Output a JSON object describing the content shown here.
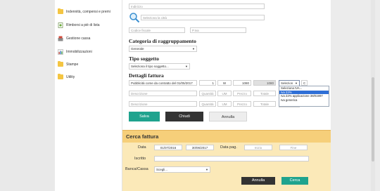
{
  "sidebar": {
    "items": [
      {
        "label": "Indennità, compensi e premi",
        "icon": "folder-icon"
      },
      {
        "label": "Rimborsi a piè di lista",
        "icon": "document-money-icon"
      },
      {
        "label": "Gestione cassa",
        "icon": "cash-register-icon"
      },
      {
        "label": "Immobilizzazioni",
        "icon": "chart-icon"
      },
      {
        "label": "Stampe",
        "icon": "folder-icon"
      },
      {
        "label": "Utility",
        "icon": "folder-icon"
      }
    ]
  },
  "form": {
    "indirizzo_placeholder": "Indirizzo",
    "city_placeholder": "Seleziona la città",
    "codice_fiscale_placeholder": "Codice fiscale",
    "piva_placeholder": "P.Iva",
    "categoria_heading": "Categoria di raggruppamento",
    "categoria_value": "Generale",
    "tipo_heading": "Tipo soggetto",
    "tipo_value": "Seleziona il tipo soggetto...",
    "dettagli_heading": "Dettagli fattura",
    "row1": {
      "descrizione": "Pubblicità come da contratto del 01/05/2017",
      "quantita": "1",
      "um": "W",
      "prezzo": "1080",
      "totale": "1080",
      "iva": "Selezion"
    },
    "row_placeholders": {
      "descrizione": "Descrizione",
      "quantita": "Quantità",
      "um": "UM",
      "prezzo": "Prezzo",
      "totale": "Totale",
      "iva": "Selezion"
    },
    "c_label": "C",
    "iva_options": [
      "Seleziona IVA...",
      "Iva 22%",
      "Iva 22% applicazione 38/01997",
      "Iva generica"
    ],
    "iva_highlight_index": 1,
    "buttons": {
      "salva": "Salva",
      "chiudi": "Chiudi",
      "annulla": "Annulla"
    }
  },
  "cerca": {
    "title": "Cerca fattura",
    "data_label": "Data",
    "data_from": "01/07/2016",
    "data_to": "30/06/2017",
    "data_pag_label": "Data pag.",
    "inizio_placeholder": "Inizio",
    "fine_placeholder": "Fine",
    "iscritto_label": "Iscritto",
    "banca_label": "Banca/Cassa",
    "banca_value": "Scegli...",
    "annulla_label": "Annulla",
    "cerca_label": "Cerca"
  },
  "colors": {
    "accent_teal": "#1fa38e",
    "dark_button": "#333333",
    "panel_bg": "#fbe9b8",
    "panel_header": "#f6cf7a",
    "highlight": "#2f6fd6"
  }
}
